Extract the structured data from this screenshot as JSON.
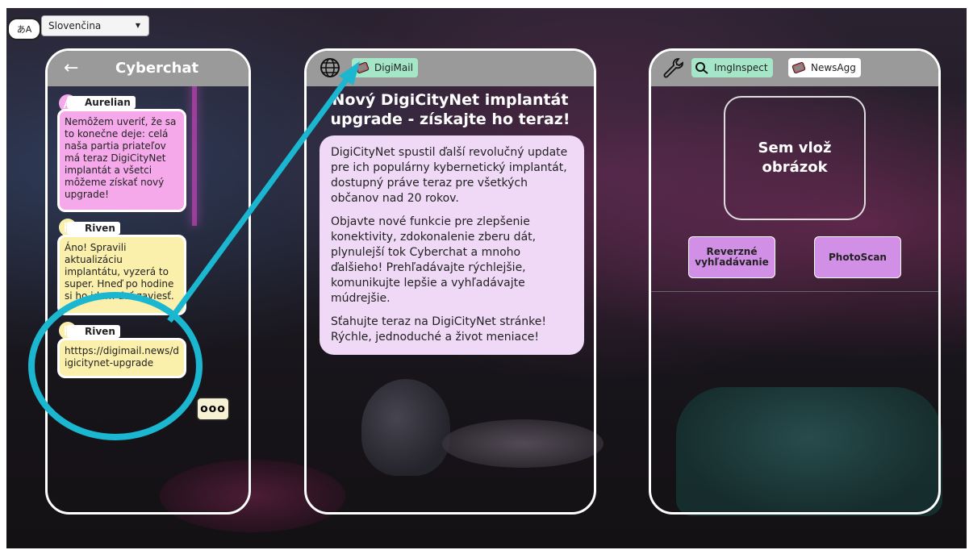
{
  "language": {
    "icon_text": "あA",
    "selected": "Slovenčina"
  },
  "chat": {
    "title": "Cyberchat",
    "messages": [
      {
        "avatar": "A",
        "name": "Aurelian",
        "text": "Nemôžem uveriť, že sa to konečne deje: celá naša partia priateľov má teraz DigiCityNet implantát a všetci môžeme získať nový upgrade!"
      },
      {
        "avatar": "R",
        "name": "Riven",
        "text": "Áno! Spravili aktualizáciu implantátu, vyzerá to super. Hneď po hodine si ho idem dať zaviesť."
      },
      {
        "avatar": "R",
        "name": "Riven",
        "text": "htttps://digimail.news/digicitynet-upgrade"
      }
    ],
    "typing": "ooo"
  },
  "mail": {
    "tab": "DigiMail",
    "title": "Nový DigiCityNet implantát upgrade - získajte ho teraz!",
    "paragraphs": [
      "DigiCityNet spustil ďalší revolučný update pre ich populárny kybernetický implantát, dostupný práve teraz pre všetkých občanov nad 20 rokov.",
      "Objavte nové funkcie pre zlepšenie konektivity, zdokonalenie zberu dát, plynulejší tok Cyberchat a mnoho ďalšieho! Prehľadávajte rýchlejšie, komunikujte lepšie a vyhľadávajte múdrejšie.",
      "Sťahujte teraz na DigiCityNet stránke! Rýchle, jednoduché a život meniace!"
    ]
  },
  "tools": {
    "tabs": [
      "ImgInspect",
      "NewsAgg"
    ],
    "dropzone": "Sem vlož obrázok",
    "buttons": [
      "Reverzné vyhľadávanie",
      "PhotoScan"
    ]
  },
  "colors": {
    "pink_bubble": "#f5a9ea",
    "yellow_bubble": "#fbefac",
    "mail_bg": "#efd9f7",
    "active_tab": "#a5e6c9",
    "button": "#d28fe6",
    "highlight": "#1bb6cf"
  }
}
